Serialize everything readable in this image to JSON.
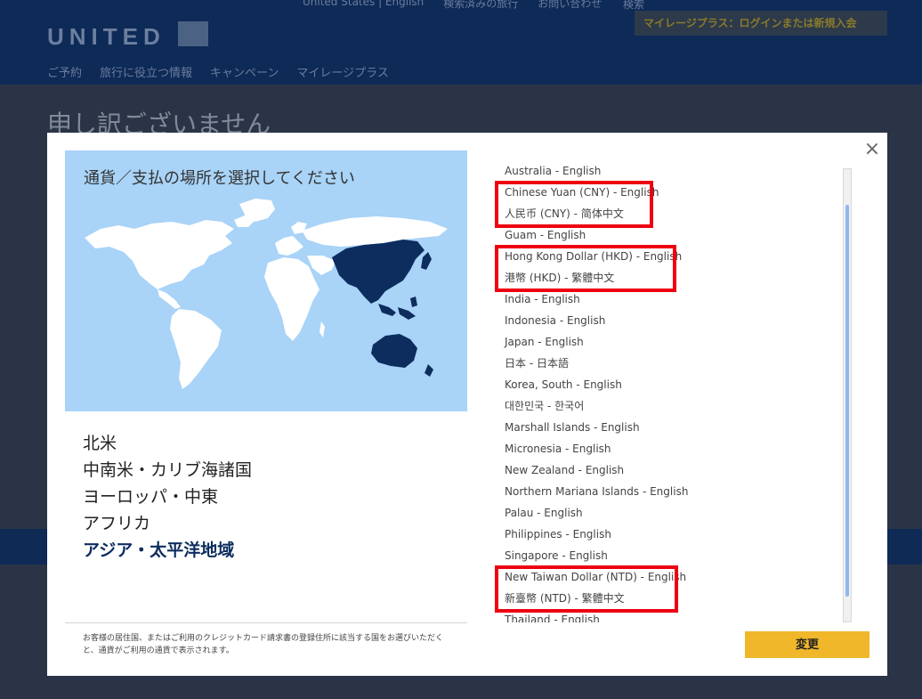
{
  "background": {
    "logo": "UNITED",
    "top_links": [
      "United States | English",
      "検索済みの旅行",
      "お問い合わせ"
    ],
    "search_placeholder": "検索",
    "login_button": "マイレージプラス：ログインまたは新規入会",
    "nav": [
      "ご予約",
      "旅行に役立つ情報",
      "キャンペーン",
      "マイレージプラス"
    ],
    "page_title": "申し訳ございません"
  },
  "modal": {
    "title": "通貨／支払の場所を選択してください",
    "close_label": "×",
    "regions": [
      {
        "label": "北米"
      },
      {
        "label": "中南米・カリブ海諸国"
      },
      {
        "label": "ヨーロッパ・中東"
      },
      {
        "label": "アフリカ"
      },
      {
        "label": "アジア・太平洋地域"
      }
    ],
    "selected_region": "アジア・太平洋地域",
    "countries": [
      "Australia - English",
      "Chinese Yuan (CNY) - English",
      "人民币 (CNY) - 简体中文",
      "Guam - English",
      "Hong Kong Dollar (HKD) - English",
      "港幣 (HKD) - 繁體中文",
      "India - English",
      "Indonesia - English",
      "Japan - English",
      "日本 - 日本語",
      "Korea, South - English",
      "대한민국 - 한국어",
      "Marshall Islands - English",
      "Micronesia - English",
      "New Zealand - English",
      "Northern Mariana Islands - English",
      "Palau - English",
      "Philippines - English",
      "Singapore - English",
      "New Taiwan Dollar (NTD) - English",
      "新臺幣 (NTD) - 繁體中文",
      "Thailand - English"
    ],
    "note": "お客様の居住国、またはご利用のクレジットカード請求書の登録住所に該当する国をお選びいただくと、通貨がご利用の通貨で表示されます。",
    "change_button": "変更"
  },
  "colors": {
    "map_ocean": "#a9d3f7",
    "map_land": "#ffffff",
    "map_selected": "#0c2d5e",
    "button": "#f0b72b",
    "highlight": "#ee0011"
  }
}
